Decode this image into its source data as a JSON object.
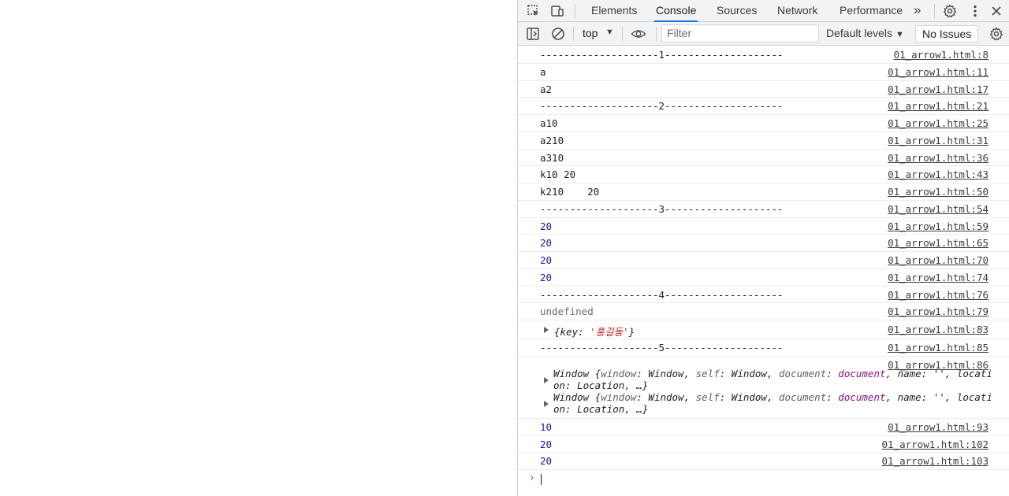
{
  "devtools": {
    "tabs": [
      "Elements",
      "Console",
      "Sources",
      "Network",
      "Performance"
    ],
    "active_tab": "Console",
    "overflow": "»"
  },
  "toolbar": {
    "context": "top",
    "filter_placeholder": "Filter",
    "levels": "Default levels",
    "issues": "No Issues"
  },
  "messages": [
    {
      "text": "--------------------1--------------------",
      "src": "01_arrow1.html:8",
      "kind": "log"
    },
    {
      "text": "a",
      "src": "01_arrow1.html:11",
      "kind": "log"
    },
    {
      "text": "a2",
      "src": "01_arrow1.html:17",
      "kind": "log"
    },
    {
      "text": "--------------------2--------------------",
      "src": "01_arrow1.html:21",
      "kind": "log"
    },
    {
      "text": "a10",
      "src": "01_arrow1.html:25",
      "kind": "log"
    },
    {
      "text": "a210",
      "src": "01_arrow1.html:31",
      "kind": "log"
    },
    {
      "text": "a310",
      "src": "01_arrow1.html:36",
      "kind": "log"
    },
    {
      "text": "k10 20",
      "src": "01_arrow1.html:43",
      "kind": "log"
    },
    {
      "text": "k210    20",
      "src": "01_arrow1.html:50",
      "kind": "log"
    },
    {
      "text": "--------------------3--------------------",
      "src": "01_arrow1.html:54",
      "kind": "log"
    },
    {
      "text": "20",
      "src": "01_arrow1.html:59",
      "kind": "num"
    },
    {
      "text": "20",
      "src": "01_arrow1.html:65",
      "kind": "num"
    },
    {
      "text": "20",
      "src": "01_arrow1.html:70",
      "kind": "num"
    },
    {
      "text": "20",
      "src": "01_arrow1.html:74",
      "kind": "num"
    },
    {
      "text": "--------------------4--------------------",
      "src": "01_arrow1.html:76",
      "kind": "log"
    },
    {
      "text": "undefined",
      "src": "01_arrow1.html:79",
      "kind": "undef"
    }
  ],
  "object_row": {
    "prefix": "{key: ",
    "value": "'홍길동'",
    "suffix": "}",
    "src": "01_arrow1.html:83"
  },
  "sep5": {
    "text": "--------------------5--------------------",
    "src": "01_arrow1.html:85"
  },
  "window_block": {
    "src": "01_arrow1.html:86",
    "lines": [
      {
        "first": "Window {",
        "k1": "window",
        "v1": ": Window, ",
        "k2": "self",
        "v2": ": Window, ",
        "k3": "document",
        "v3": ": ",
        "doc": "document",
        "rest": ", name: '', locati",
        "line2": "on: Location, …}"
      },
      {
        "first": "Window {",
        "k1": "window",
        "v1": ": Window, ",
        "k2": "self",
        "v2": ": Window, ",
        "k3": "document",
        "v3": ": ",
        "doc": "document",
        "rest": ", name: '', locati",
        "line2": "on: Location, …}"
      }
    ]
  },
  "tail_messages": [
    {
      "text": "10",
      "src": "01_arrow1.html:93",
      "kind": "num"
    },
    {
      "text": "20",
      "src": "01_arrow1.html:102",
      "kind": "num"
    },
    {
      "text": "20",
      "src": "01_arrow1.html:103",
      "kind": "num"
    }
  ],
  "prompt": "›"
}
